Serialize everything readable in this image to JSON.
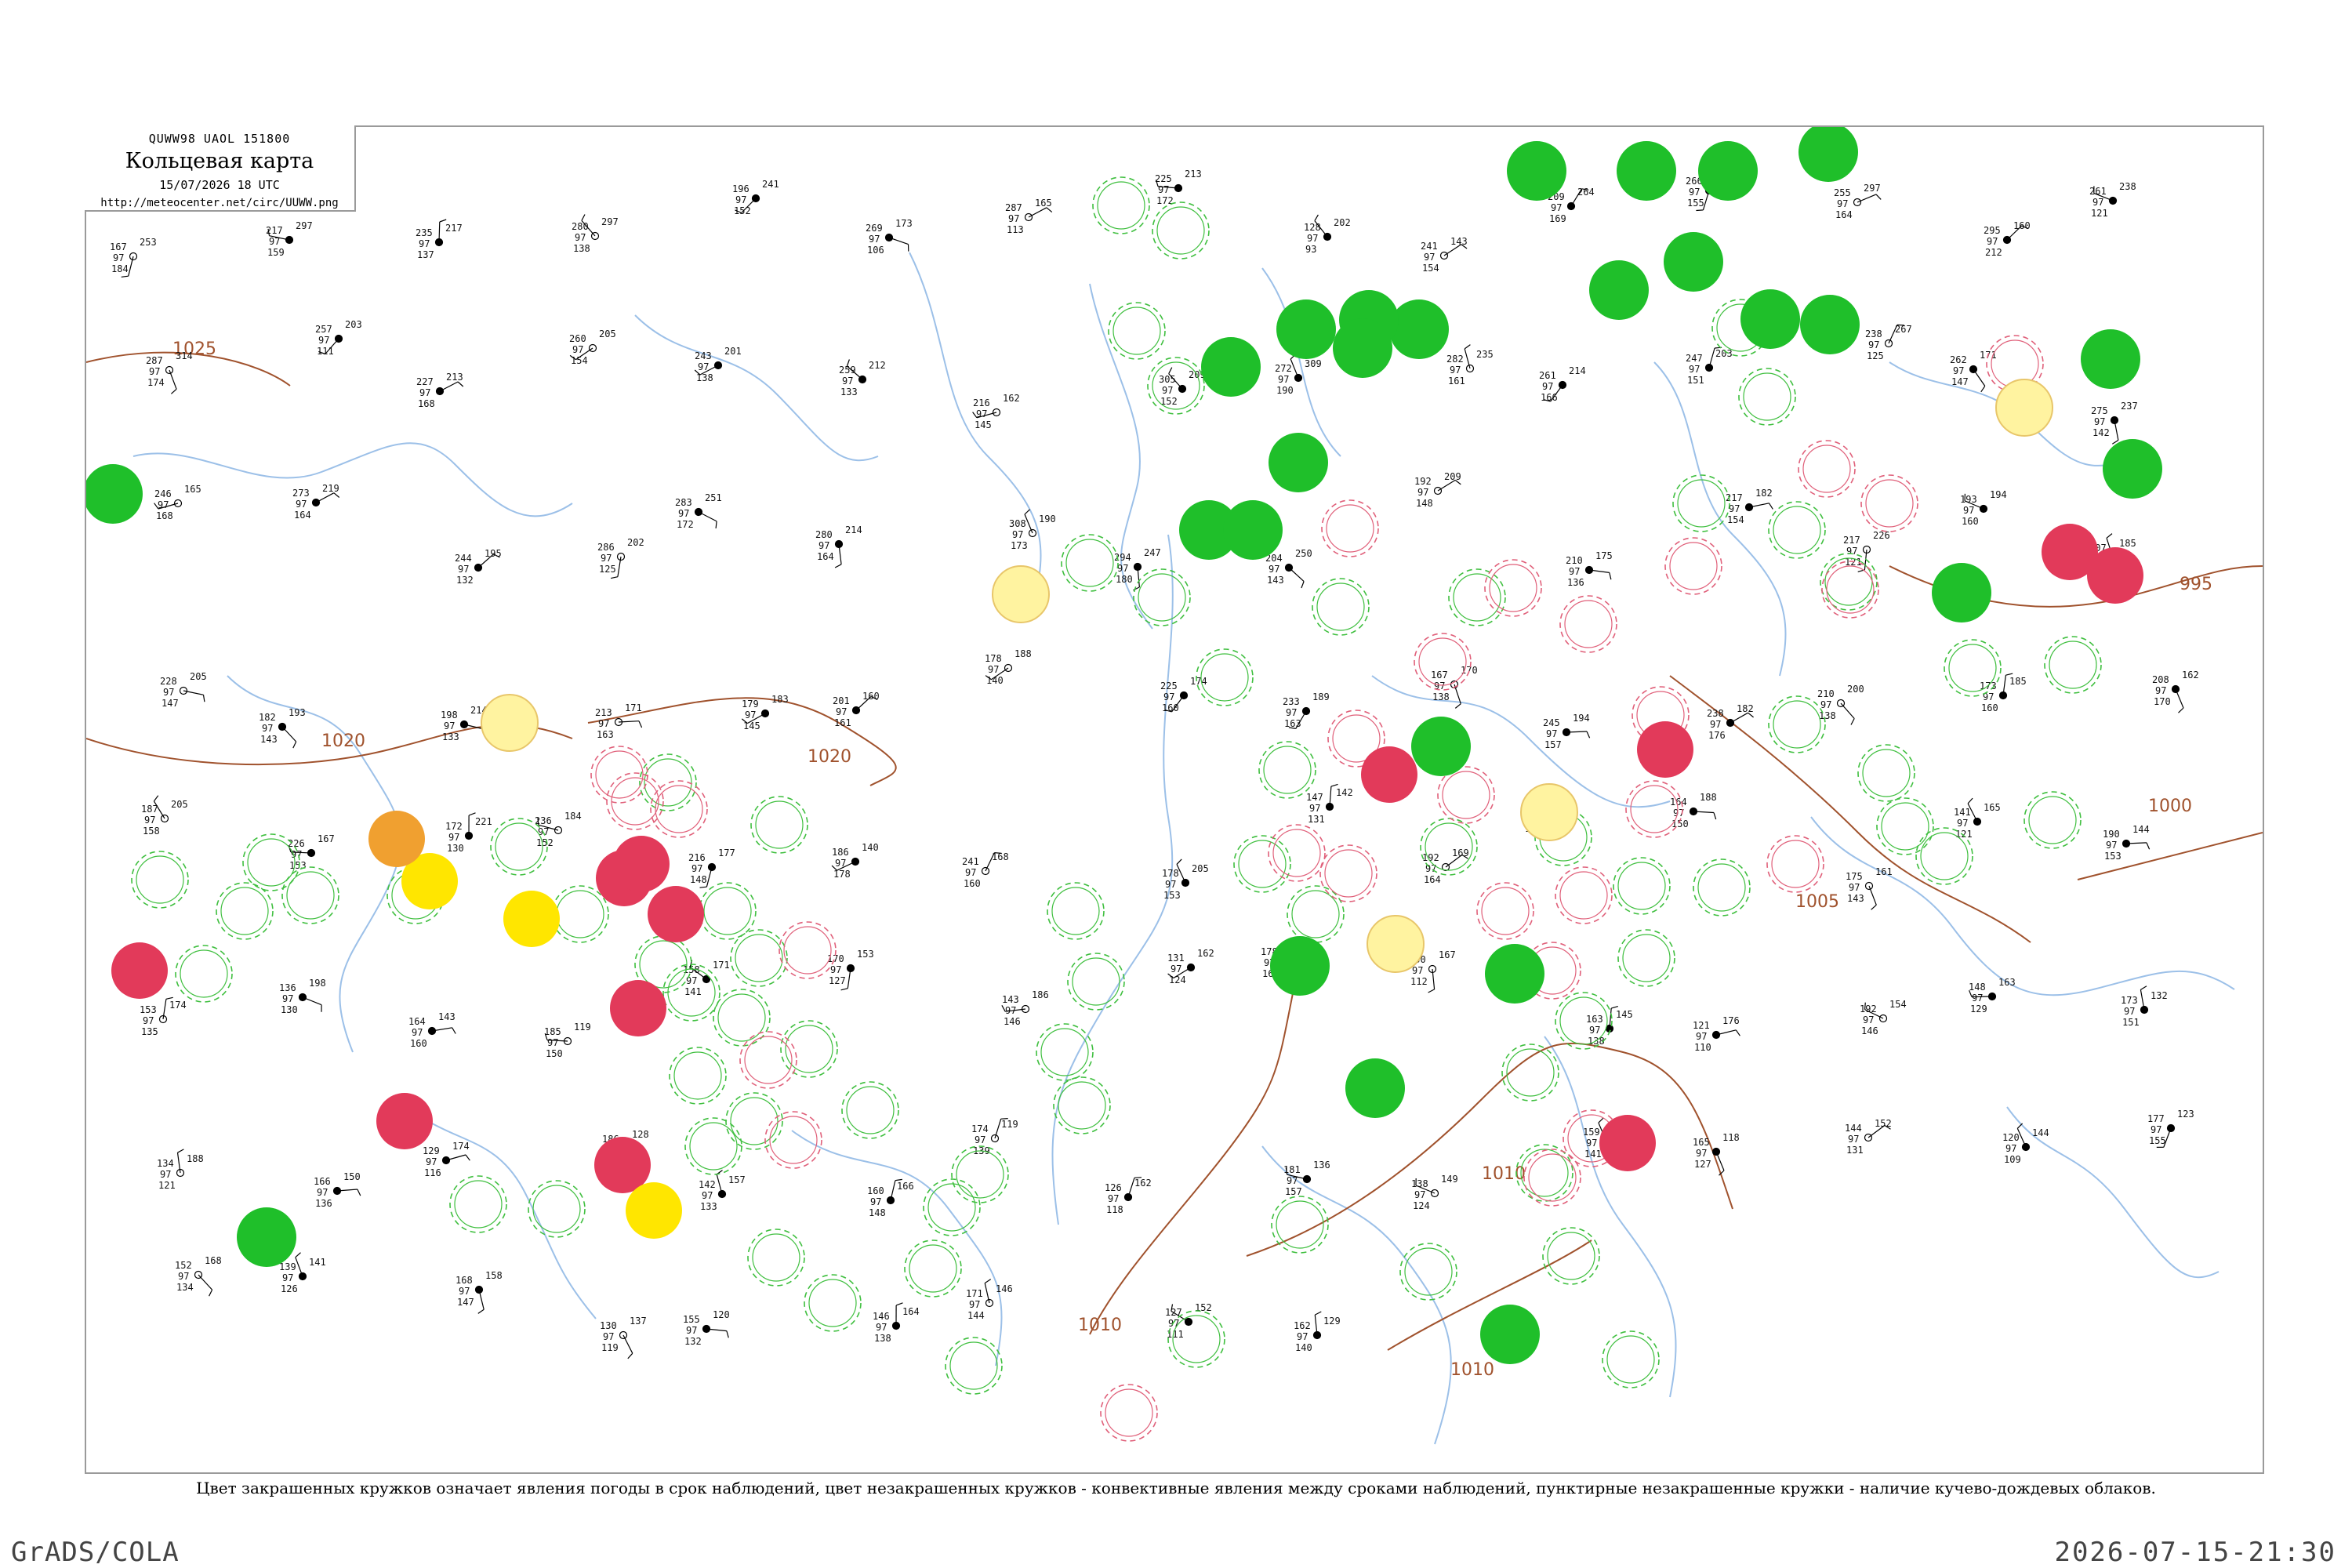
{
  "header": {
    "code": "QUWW98  UAOL  151800",
    "title": "Кольцевая карта",
    "valid": "15/07/2026 18 UTC",
    "url": "http://meteocenter.net/circ/UUWW.png"
  },
  "legend": "Цвет закрашенных кружков означает явления погоды в срок наблюдений, цвет незакрашенных кружков - конвективные явления между сроками наблюдений, пунктирные незакрашенные кружки - наличие кучево-дождевых облаков.",
  "footer": {
    "left": "GrADS/COLA",
    "right": "2026-07-15-21:30"
  },
  "colors": {
    "frame": "#9a9a9a",
    "river": "#9cc0e8",
    "isobar": "#a0522d",
    "green": "#1fbf2a",
    "red": "#e23a5a",
    "yellow": "#ffe600",
    "orange": "#f0a030",
    "lightyellow": "#fff3a0",
    "pink": "#f29ab0"
  },
  "isobars": [
    {
      "label": "1025"
    },
    {
      "label": "1020"
    },
    {
      "label": "1020"
    },
    {
      "label": "1010"
    },
    {
      "label": "1010"
    },
    {
      "label": "1010"
    },
    {
      "label": "1005"
    },
    {
      "label": "1000"
    },
    {
      "label": "995"
    }
  ],
  "filled_circles": [
    {
      "color": "green"
    },
    {
      "color": "green"
    },
    {
      "color": "green"
    },
    {
      "color": "green"
    },
    {
      "color": "green"
    },
    {
      "color": "green"
    },
    {
      "color": "green"
    },
    {
      "color": "green"
    },
    {
      "color": "green"
    },
    {
      "color": "green"
    },
    {
      "color": "green"
    },
    {
      "color": "green"
    },
    {
      "color": "green"
    },
    {
      "color": "green"
    },
    {
      "color": "green"
    },
    {
      "color": "green"
    },
    {
      "color": "green"
    },
    {
      "color": "green"
    },
    {
      "color": "green"
    },
    {
      "color": "green"
    },
    {
      "color": "green"
    },
    {
      "color": "green"
    },
    {
      "color": "green"
    },
    {
      "color": "green"
    },
    {
      "color": "green"
    },
    {
      "color": "green"
    },
    {
      "color": "red"
    },
    {
      "color": "red"
    },
    {
      "color": "red"
    },
    {
      "color": "red"
    },
    {
      "color": "red"
    },
    {
      "color": "red"
    },
    {
      "color": "red"
    },
    {
      "color": "red"
    },
    {
      "color": "red"
    },
    {
      "color": "red"
    },
    {
      "color": "red"
    },
    {
      "color": "red"
    },
    {
      "color": "yellow"
    },
    {
      "color": "yellow"
    },
    {
      "color": "yellow"
    },
    {
      "color": "orange"
    },
    {
      "color": "lightyellow"
    },
    {
      "color": "lightyellow"
    },
    {
      "color": "lightyellow"
    },
    {
      "color": "lightyellow"
    },
    {
      "color": "lightyellow"
    }
  ],
  "stations": [
    {
      "t": "167",
      "d": "97",
      "p": "184",
      "n": "253"
    },
    {
      "t": "217",
      "d": "97",
      "p": "159",
      "n": "297"
    },
    {
      "t": "235",
      "d": "97",
      "p": "137",
      "n": "217"
    },
    {
      "t": "280",
      "d": "97",
      "p": "138",
      "n": "297"
    },
    {
      "t": "196",
      "d": "97",
      "p": "152",
      "n": "241"
    },
    {
      "t": "269",
      "d": "97",
      "p": "106",
      "n": "173"
    },
    {
      "t": "287",
      "d": "97",
      "p": "113",
      "n": "165"
    },
    {
      "t": "225",
      "d": "97",
      "p": "172",
      "n": "213"
    },
    {
      "t": "128",
      "d": "97",
      "p": "93",
      "n": "202"
    },
    {
      "t": "241",
      "d": "97",
      "p": "154",
      "n": "143"
    },
    {
      "t": "209",
      "d": "97",
      "p": "169",
      "n": "264"
    },
    {
      "t": "266",
      "d": "97",
      "p": "155",
      "n": "193"
    },
    {
      "t": "255",
      "d": "97",
      "p": "164",
      "n": "297"
    },
    {
      "t": "295",
      "d": "97",
      "p": "212",
      "n": "160"
    },
    {
      "t": "261",
      "d": "97",
      "p": "121",
      "n": "238"
    },
    {
      "t": "287",
      "d": "97",
      "p": "174",
      "n": "314"
    },
    {
      "t": "257",
      "d": "97",
      "p": "111",
      "n": "203"
    },
    {
      "t": "227",
      "d": "97",
      "p": "168",
      "n": "213"
    },
    {
      "t": "260",
      "d": "97",
      "p": "154",
      "n": "205"
    },
    {
      "t": "243",
      "d": "97",
      "p": "138",
      "n": "201"
    },
    {
      "t": "259",
      "d": "97",
      "p": "133",
      "n": "212"
    },
    {
      "t": "216",
      "d": "97",
      "p": "145",
      "n": "162"
    },
    {
      "t": "305",
      "d": "97",
      "p": "152",
      "n": "209"
    },
    {
      "t": "272",
      "d": "97",
      "p": "190",
      "n": "309"
    },
    {
      "t": "282",
      "d": "97",
      "p": "161",
      "n": "235"
    },
    {
      "t": "261",
      "d": "97",
      "p": "166",
      "n": "214"
    },
    {
      "t": "247",
      "d": "97",
      "p": "151",
      "n": "203"
    },
    {
      "t": "238",
      "d": "97",
      "p": "125",
      "n": "267"
    },
    {
      "t": "262",
      "d": "97",
      "p": "147",
      "n": "171"
    },
    {
      "t": "275",
      "d": "97",
      "p": "142",
      "n": "237"
    },
    {
      "t": "246",
      "d": "97",
      "p": "168",
      "n": "165"
    },
    {
      "t": "273",
      "d": "97",
      "p": "164",
      "n": "219"
    },
    {
      "t": "244",
      "d": "97",
      "p": "132",
      "n": "195"
    },
    {
      "t": "286",
      "d": "97",
      "p": "125",
      "n": "202"
    },
    {
      "t": "283",
      "d": "97",
      "p": "172",
      "n": "251"
    },
    {
      "t": "280",
      "d": "97",
      "p": "164",
      "n": "214"
    },
    {
      "t": "308",
      "d": "97",
      "p": "173",
      "n": "190"
    },
    {
      "t": "294",
      "d": "97",
      "p": "180",
      "n": "247"
    },
    {
      "t": "204",
      "d": "97",
      "p": "143",
      "n": "250"
    },
    {
      "t": "192",
      "d": "97",
      "p": "148",
      "n": "209"
    },
    {
      "t": "210",
      "d": "97",
      "p": "136",
      "n": "175"
    },
    {
      "t": "217",
      "d": "97",
      "p": "154",
      "n": "182"
    },
    {
      "t": "217",
      "d": "97",
      "p": "121",
      "n": "226"
    },
    {
      "t": "193",
      "d": "97",
      "p": "160",
      "n": "194"
    },
    {
      "t": "207",
      "d": "97",
      "p": "126",
      "n": "185"
    },
    {
      "t": "228",
      "d": "97",
      "p": "147",
      "n": "205"
    },
    {
      "t": "182",
      "d": "97",
      "p": "143",
      "n": "193"
    },
    {
      "t": "198",
      "d": "97",
      "p": "133",
      "n": "214"
    },
    {
      "t": "213",
      "d": "97",
      "p": "163",
      "n": "171"
    },
    {
      "t": "179",
      "d": "97",
      "p": "145",
      "n": "183"
    },
    {
      "t": "201",
      "d": "97",
      "p": "161",
      "n": "160"
    },
    {
      "t": "178",
      "d": "97",
      "p": "140",
      "n": "188"
    },
    {
      "t": "225",
      "d": "97",
      "p": "160",
      "n": "174"
    },
    {
      "t": "233",
      "d": "97",
      "p": "163",
      "n": "189"
    },
    {
      "t": "167",
      "d": "97",
      "p": "138",
      "n": "170"
    },
    {
      "t": "245",
      "d": "97",
      "p": "157",
      "n": "194"
    },
    {
      "t": "238",
      "d": "97",
      "p": "176",
      "n": "182"
    },
    {
      "t": "210",
      "d": "97",
      "p": "138",
      "n": "200"
    },
    {
      "t": "173",
      "d": "97",
      "p": "160",
      "n": "185"
    },
    {
      "t": "208",
      "d": "97",
      "p": "170",
      "n": "162"
    },
    {
      "t": "187",
      "d": "97",
      "p": "158",
      "n": "205"
    },
    {
      "t": "226",
      "d": "97",
      "p": "153",
      "n": "167"
    },
    {
      "t": "172",
      "d": "97",
      "p": "130",
      "n": "221"
    },
    {
      "t": "236",
      "d": "97",
      "p": "152",
      "n": "184"
    },
    {
      "t": "216",
      "d": "97",
      "p": "148",
      "n": "177"
    },
    {
      "t": "186",
      "d": "97",
      "p": "178",
      "n": "140"
    },
    {
      "t": "241",
      "d": "97",
      "p": "160",
      "n": "168"
    },
    {
      "t": "178",
      "d": "97",
      "p": "153",
      "n": "205"
    },
    {
      "t": "147",
      "d": "97",
      "p": "131",
      "n": "142"
    },
    {
      "t": "192",
      "d": "97",
      "p": "164",
      "n": "169"
    },
    {
      "t": "208",
      "d": "97",
      "p": "142",
      "n": "147"
    },
    {
      "t": "164",
      "d": "97",
      "p": "150",
      "n": "188"
    },
    {
      "t": "175",
      "d": "97",
      "p": "143",
      "n": "161"
    },
    {
      "t": "141",
      "d": "97",
      "p": "121",
      "n": "165"
    },
    {
      "t": "190",
      "d": "97",
      "p": "153",
      "n": "144"
    },
    {
      "t": "153",
      "d": "97",
      "p": "135",
      "n": "174"
    },
    {
      "t": "136",
      "d": "97",
      "p": "130",
      "n": "198"
    },
    {
      "t": "164",
      "d": "97",
      "p": "160",
      "n": "143"
    },
    {
      "t": "185",
      "d": "97",
      "p": "150",
      "n": "119"
    },
    {
      "t": "158",
      "d": "97",
      "p": "141",
      "n": "171"
    },
    {
      "t": "170",
      "d": "97",
      "p": "127",
      "n": "153"
    },
    {
      "t": "143",
      "d": "97",
      "p": "146",
      "n": "186"
    },
    {
      "t": "131",
      "d": "97",
      "p": "124",
      "n": "162"
    },
    {
      "t": "178",
      "d": "97",
      "p": "163",
      "n": "140"
    },
    {
      "t": "150",
      "d": "97",
      "p": "112",
      "n": "167"
    },
    {
      "t": "163",
      "d": "97",
      "p": "138",
      "n": "145"
    },
    {
      "t": "121",
      "d": "97",
      "p": "110",
      "n": "176"
    },
    {
      "t": "192",
      "d": "97",
      "p": "146",
      "n": "154"
    },
    {
      "t": "148",
      "d": "97",
      "p": "129",
      "n": "163"
    },
    {
      "t": "173",
      "d": "97",
      "p": "151",
      "n": "132"
    },
    {
      "t": "134",
      "d": "97",
      "p": "121",
      "n": "188"
    },
    {
      "t": "166",
      "d": "97",
      "p": "136",
      "n": "150"
    },
    {
      "t": "129",
      "d": "97",
      "p": "116",
      "n": "174"
    },
    {
      "t": "186",
      "d": "97",
      "p": "143",
      "n": "128"
    },
    {
      "t": "142",
      "d": "97",
      "p": "133",
      "n": "157"
    },
    {
      "t": "160",
      "d": "97",
      "p": "148",
      "n": "166"
    },
    {
      "t": "174",
      "d": "97",
      "p": "139",
      "n": "119"
    },
    {
      "t": "126",
      "d": "97",
      "p": "118",
      "n": "162"
    },
    {
      "t": "181",
      "d": "97",
      "p": "157",
      "n": "136"
    },
    {
      "t": "138",
      "d": "97",
      "p": "124",
      "n": "149"
    },
    {
      "t": "159",
      "d": "97",
      "p": "141",
      "n": "170"
    },
    {
      "t": "165",
      "d": "97",
      "p": "127",
      "n": "118"
    },
    {
      "t": "144",
      "d": "97",
      "p": "131",
      "n": "152"
    },
    {
      "t": "120",
      "d": "97",
      "p": "109",
      "n": "144"
    },
    {
      "t": "177",
      "d": "97",
      "p": "155",
      "n": "123"
    },
    {
      "t": "152",
      "d": "97",
      "p": "134",
      "n": "168"
    },
    {
      "t": "139",
      "d": "97",
      "p": "126",
      "n": "141"
    },
    {
      "t": "168",
      "d": "97",
      "p": "147",
      "n": "158"
    },
    {
      "t": "130",
      "d": "97",
      "p": "119",
      "n": "137"
    },
    {
      "t": "155",
      "d": "97",
      "p": "132",
      "n": "120"
    },
    {
      "t": "146",
      "d": "97",
      "p": "138",
      "n": "164"
    },
    {
      "t": "171",
      "d": "97",
      "p": "144",
      "n": "146"
    },
    {
      "t": "127",
      "d": "97",
      "p": "111",
      "n": "152"
    },
    {
      "t": "162",
      "d": "97",
      "p": "140",
      "n": "129"
    }
  ]
}
